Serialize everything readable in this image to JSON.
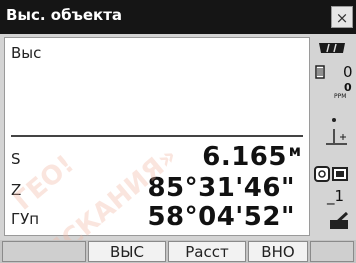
{
  "window": {
    "title": "Выс. объекта",
    "close_label": "×"
  },
  "main": {
    "top_label": "Выс",
    "rows": [
      {
        "label": "S",
        "value": "6.165",
        "unit": "м"
      },
      {
        "label": "Z",
        "value": "85°31'46\""
      },
      {
        "label": "ГУп",
        "value": "58°04'52\""
      }
    ]
  },
  "status": {
    "battery_icon": "battery-icon",
    "prism_constant": "0",
    "ppm_value": "0",
    "ppm_unit": "PPM",
    "tilt_icon": "tilt-icon",
    "mode_icon": "target-mode-icon",
    "input_mode": "_1",
    "menu_icon": "pen-icon"
  },
  "watermark": {
    "line1": "ГЕО!",
    "line2": "ИСКАНИЯ»"
  },
  "softkeys": [
    {
      "label": ""
    },
    {
      "label": "ВЫС"
    },
    {
      "label": "Расст"
    },
    {
      "label": "ВНО"
    },
    {
      "label": ""
    }
  ]
}
